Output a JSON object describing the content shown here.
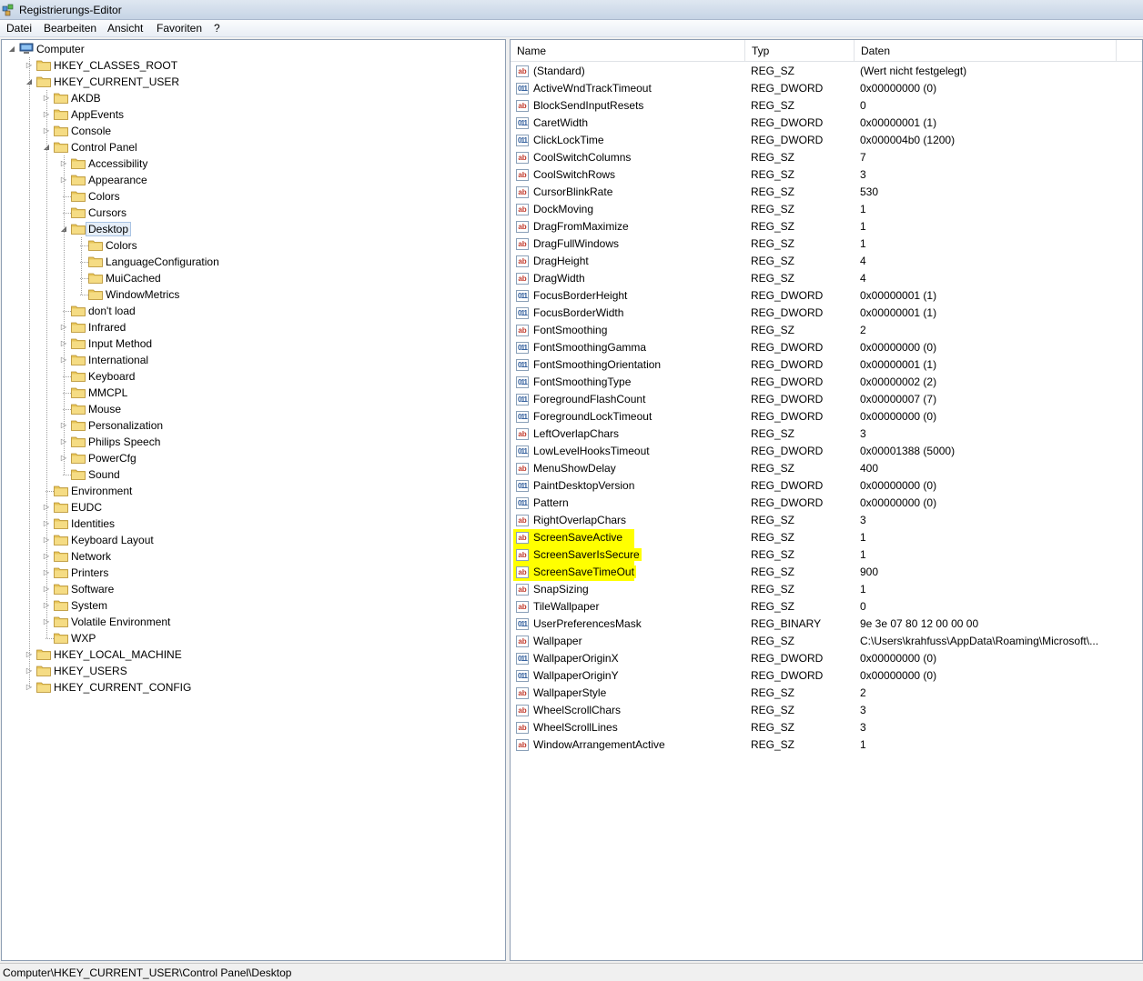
{
  "window": {
    "title": "Registrierungs-Editor"
  },
  "menu": [
    "Datei",
    "Bearbeiten",
    "Ansicht",
    "Favoriten",
    "?"
  ],
  "tree": [
    {
      "label": "Computer",
      "depth": 0,
      "expander": "open",
      "icon": "computer-icon"
    },
    {
      "label": "HKEY_CLASSES_ROOT",
      "depth": 1,
      "expander": "closed"
    },
    {
      "label": "HKEY_CURRENT_USER",
      "depth": 1,
      "expander": "open"
    },
    {
      "label": "AKDB",
      "depth": 2,
      "expander": "closed"
    },
    {
      "label": "AppEvents",
      "depth": 2,
      "expander": "closed"
    },
    {
      "label": "Console",
      "depth": 2,
      "expander": "closed"
    },
    {
      "label": "Control Panel",
      "depth": 2,
      "expander": "open"
    },
    {
      "label": "Accessibility",
      "depth": 3,
      "expander": "closed"
    },
    {
      "label": "Appearance",
      "depth": 3,
      "expander": "closed"
    },
    {
      "label": "Colors",
      "depth": 3,
      "expander": "none"
    },
    {
      "label": "Cursors",
      "depth": 3,
      "expander": "none"
    },
    {
      "label": "Desktop",
      "depth": 3,
      "expander": "open",
      "selected": true
    },
    {
      "label": "Colors",
      "depth": 4,
      "expander": "none"
    },
    {
      "label": "LanguageConfiguration",
      "depth": 4,
      "expander": "none"
    },
    {
      "label": "MuiCached",
      "depth": 4,
      "expander": "none"
    },
    {
      "label": "WindowMetrics",
      "depth": 4,
      "expander": "none"
    },
    {
      "label": "don't load",
      "depth": 3,
      "expander": "none"
    },
    {
      "label": "Infrared",
      "depth": 3,
      "expander": "closed"
    },
    {
      "label": "Input Method",
      "depth": 3,
      "expander": "closed"
    },
    {
      "label": "International",
      "depth": 3,
      "expander": "closed"
    },
    {
      "label": "Keyboard",
      "depth": 3,
      "expander": "none"
    },
    {
      "label": "MMCPL",
      "depth": 3,
      "expander": "none"
    },
    {
      "label": "Mouse",
      "depth": 3,
      "expander": "none"
    },
    {
      "label": "Personalization",
      "depth": 3,
      "expander": "closed"
    },
    {
      "label": "Philips Speech",
      "depth": 3,
      "expander": "closed"
    },
    {
      "label": "PowerCfg",
      "depth": 3,
      "expander": "closed"
    },
    {
      "label": "Sound",
      "depth": 3,
      "expander": "none"
    },
    {
      "label": "Environment",
      "depth": 2,
      "expander": "none"
    },
    {
      "label": "EUDC",
      "depth": 2,
      "expander": "closed"
    },
    {
      "label": "Identities",
      "depth": 2,
      "expander": "closed"
    },
    {
      "label": "Keyboard Layout",
      "depth": 2,
      "expander": "closed"
    },
    {
      "label": "Network",
      "depth": 2,
      "expander": "closed"
    },
    {
      "label": "Printers",
      "depth": 2,
      "expander": "closed"
    },
    {
      "label": "Software",
      "depth": 2,
      "expander": "closed"
    },
    {
      "label": "System",
      "depth": 2,
      "expander": "closed"
    },
    {
      "label": "Volatile Environment",
      "depth": 2,
      "expander": "closed"
    },
    {
      "label": "WXP",
      "depth": 2,
      "expander": "none"
    },
    {
      "label": "HKEY_LOCAL_MACHINE",
      "depth": 1,
      "expander": "closed"
    },
    {
      "label": "HKEY_USERS",
      "depth": 1,
      "expander": "closed"
    },
    {
      "label": "HKEY_CURRENT_CONFIG",
      "depth": 1,
      "expander": "closed"
    }
  ],
  "columns": {
    "name": "Name",
    "type": "Typ",
    "data": "Daten"
  },
  "values": [
    {
      "name": "(Standard)",
      "type": "REG_SZ",
      "data": "(Wert nicht festgelegt)",
      "icon": "string-value-icon"
    },
    {
      "name": "ActiveWndTrackTimeout",
      "type": "REG_DWORD",
      "data": "0x00000000 (0)",
      "icon": "binary-value-icon"
    },
    {
      "name": "BlockSendInputResets",
      "type": "REG_SZ",
      "data": "0",
      "icon": "string-value-icon"
    },
    {
      "name": "CaretWidth",
      "type": "REG_DWORD",
      "data": "0x00000001 (1)",
      "icon": "binary-value-icon"
    },
    {
      "name": "ClickLockTime",
      "type": "REG_DWORD",
      "data": "0x000004b0 (1200)",
      "icon": "binary-value-icon"
    },
    {
      "name": "CoolSwitchColumns",
      "type": "REG_SZ",
      "data": "7",
      "icon": "string-value-icon"
    },
    {
      "name": "CoolSwitchRows",
      "type": "REG_SZ",
      "data": "3",
      "icon": "string-value-icon"
    },
    {
      "name": "CursorBlinkRate",
      "type": "REG_SZ",
      "data": "530",
      "icon": "string-value-icon"
    },
    {
      "name": "DockMoving",
      "type": "REG_SZ",
      "data": "1",
      "icon": "string-value-icon"
    },
    {
      "name": "DragFromMaximize",
      "type": "REG_SZ",
      "data": "1",
      "icon": "string-value-icon"
    },
    {
      "name": "DragFullWindows",
      "type": "REG_SZ",
      "data": "1",
      "icon": "string-value-icon"
    },
    {
      "name": "DragHeight",
      "type": "REG_SZ",
      "data": "4",
      "icon": "string-value-icon"
    },
    {
      "name": "DragWidth",
      "type": "REG_SZ",
      "data": "4",
      "icon": "string-value-icon"
    },
    {
      "name": "FocusBorderHeight",
      "type": "REG_DWORD",
      "data": "0x00000001 (1)",
      "icon": "binary-value-icon"
    },
    {
      "name": "FocusBorderWidth",
      "type": "REG_DWORD",
      "data": "0x00000001 (1)",
      "icon": "binary-value-icon"
    },
    {
      "name": "FontSmoothing",
      "type": "REG_SZ",
      "data": "2",
      "icon": "string-value-icon"
    },
    {
      "name": "FontSmoothingGamma",
      "type": "REG_DWORD",
      "data": "0x00000000 (0)",
      "icon": "binary-value-icon"
    },
    {
      "name": "FontSmoothingOrientation",
      "type": "REG_DWORD",
      "data": "0x00000001 (1)",
      "icon": "binary-value-icon"
    },
    {
      "name": "FontSmoothingType",
      "type": "REG_DWORD",
      "data": "0x00000002 (2)",
      "icon": "binary-value-icon"
    },
    {
      "name": "ForegroundFlashCount",
      "type": "REG_DWORD",
      "data": "0x00000007 (7)",
      "icon": "binary-value-icon"
    },
    {
      "name": "ForegroundLockTimeout",
      "type": "REG_DWORD",
      "data": "0x00000000 (0)",
      "icon": "binary-value-icon"
    },
    {
      "name": "LeftOverlapChars",
      "type": "REG_SZ",
      "data": "3",
      "icon": "string-value-icon"
    },
    {
      "name": "LowLevelHooksTimeout",
      "type": "REG_DWORD",
      "data": "0x00001388 (5000)",
      "icon": "binary-value-icon"
    },
    {
      "name": "MenuShowDelay",
      "type": "REG_SZ",
      "data": "400",
      "icon": "string-value-icon"
    },
    {
      "name": "PaintDesktopVersion",
      "type": "REG_DWORD",
      "data": "0x00000000 (0)",
      "icon": "binary-value-icon"
    },
    {
      "name": "Pattern",
      "type": "REG_DWORD",
      "data": "0x00000000 (0)",
      "icon": "binary-value-icon"
    },
    {
      "name": "RightOverlapChars",
      "type": "REG_SZ",
      "data": "3",
      "icon": "string-value-icon"
    },
    {
      "name": "ScreenSaveActive",
      "type": "REG_SZ",
      "data": "1",
      "icon": "string-value-icon",
      "highlight": true
    },
    {
      "name": "ScreenSaverIsSecure",
      "type": "REG_SZ",
      "data": "1",
      "icon": "string-value-icon",
      "highlight": true
    },
    {
      "name": "ScreenSaveTimeOut",
      "type": "REG_SZ",
      "data": "900",
      "icon": "string-value-icon",
      "highlight": true
    },
    {
      "name": "SnapSizing",
      "type": "REG_SZ",
      "data": "1",
      "icon": "string-value-icon"
    },
    {
      "name": "TileWallpaper",
      "type": "REG_SZ",
      "data": "0",
      "icon": "string-value-icon"
    },
    {
      "name": "UserPreferencesMask",
      "type": "REG_BINARY",
      "data": "9e 3e 07 80 12 00 00 00",
      "icon": "binary-value-icon"
    },
    {
      "name": "Wallpaper",
      "type": "REG_SZ",
      "data": "C:\\Users\\krahfuss\\AppData\\Roaming\\Microsoft\\...",
      "icon": "string-value-icon"
    },
    {
      "name": "WallpaperOriginX",
      "type": "REG_DWORD",
      "data": "0x00000000 (0)",
      "icon": "binary-value-icon"
    },
    {
      "name": "WallpaperOriginY",
      "type": "REG_DWORD",
      "data": "0x00000000 (0)",
      "icon": "binary-value-icon"
    },
    {
      "name": "WallpaperStyle",
      "type": "REG_SZ",
      "data": "2",
      "icon": "string-value-icon"
    },
    {
      "name": "WheelScrollChars",
      "type": "REG_SZ",
      "data": "3",
      "icon": "string-value-icon"
    },
    {
      "name": "WheelScrollLines",
      "type": "REG_SZ",
      "data": "3",
      "icon": "string-value-icon"
    },
    {
      "name": "WindowArrangementActive",
      "type": "REG_SZ",
      "data": "1",
      "icon": "string-value-icon"
    }
  ],
  "status": {
    "path": "Computer\\HKEY_CURRENT_USER\\Control Panel\\Desktop"
  },
  "colors": {
    "highlight": "#ffff00",
    "folder": "#e8c65a",
    "selection": "#e5eef8"
  }
}
